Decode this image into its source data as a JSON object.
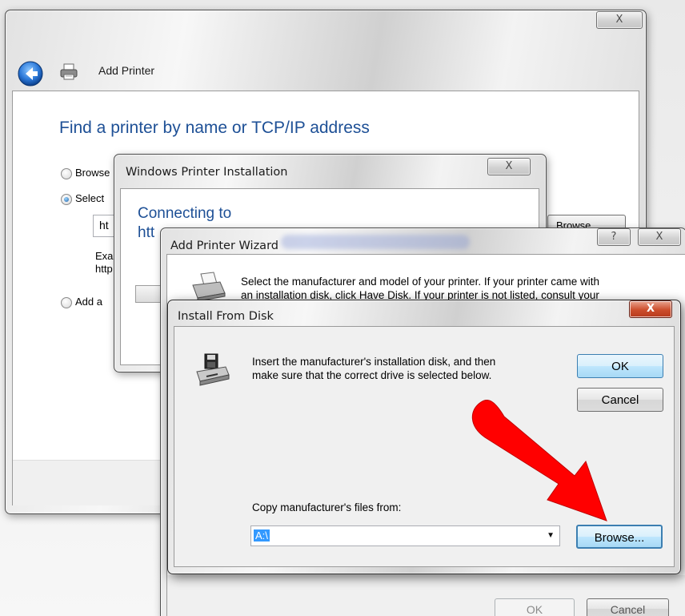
{
  "add_printer": {
    "close_glyph": "X",
    "title": "Add Printer",
    "heading": "Find a printer by name or TCP/IP address",
    "options": [
      {
        "label": "Browse"
      },
      {
        "label": "Select"
      },
      {
        "label": "Add a"
      }
    ],
    "url_value_partial": "ht",
    "example_line1": "Exa",
    "example_line2": "http",
    "browse_button_label": "Browse..."
  },
  "printer_installation": {
    "title": "Windows Printer Installation",
    "close_glyph": "X",
    "connecting_label": "Connecting to",
    "url_prefix": "htt"
  },
  "wizard": {
    "title": "Add Printer Wizard",
    "help_glyph": "?",
    "close_glyph": "X",
    "instruction_line1": "Select the manufacturer and model of your printer. If your printer came with",
    "instruction_line2": "an installation disk, click Have Disk. If your printer is not listed, consult your",
    "ok_label": "OK",
    "cancel_label": "Cancel"
  },
  "install_disk": {
    "title": "Install From Disk",
    "close_glyph": "X",
    "message_line1": "Insert the manufacturer's installation disk, and then",
    "message_line2": "make sure that the correct drive is selected below.",
    "ok_label": "OK",
    "cancel_label": "Cancel",
    "copy_label": "Copy manufacturer's files from:",
    "path_value": "A:\\",
    "dropdown_arrow": "▼",
    "browse_label": "Browse..."
  },
  "colors": {
    "heading_blue": "#1e5096",
    "annotation_red": "#ff0000",
    "selection_blue": "#3399ff"
  }
}
